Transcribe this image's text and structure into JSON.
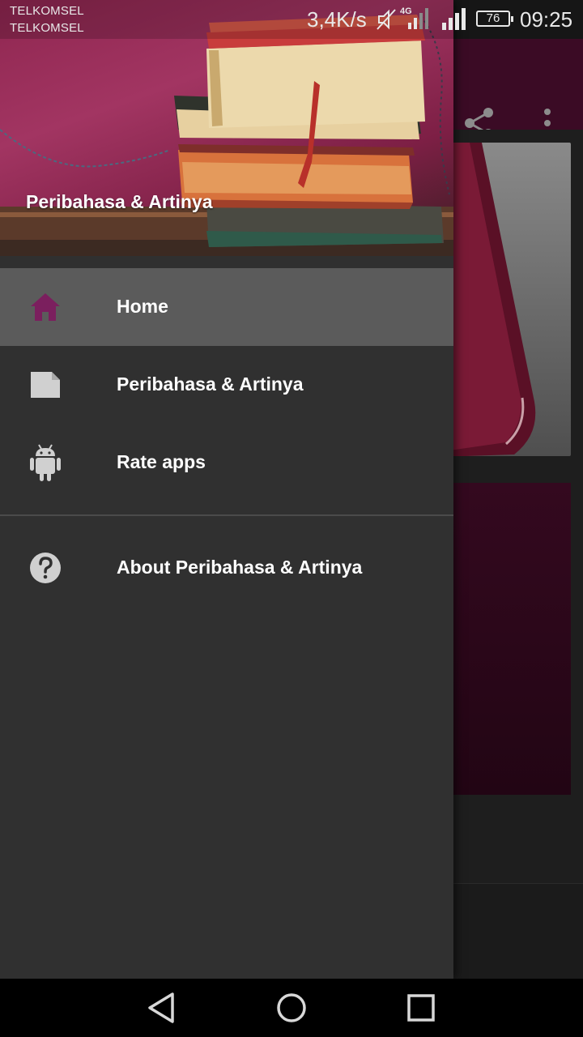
{
  "status_bar": {
    "carrier_1": "TELKOMSEL",
    "carrier_2": "TELKOMSEL",
    "net_speed": "3,4K/s",
    "battery": "76",
    "time": "09:25",
    "icons": [
      "mute-icon",
      "signal-4g-icon",
      "signal-icon",
      "battery-icon"
    ]
  },
  "app_toolbar": {
    "actions": [
      "share-icon",
      "more-vert-icon"
    ]
  },
  "drawer": {
    "header_title": "Peribahasa & Artinya",
    "items": [
      {
        "label": "Home",
        "icon": "home-icon",
        "active": true
      },
      {
        "label": "Peribahasa & Artinya",
        "icon": "note-icon",
        "active": false
      },
      {
        "label": "Rate apps",
        "icon": "android-icon",
        "active": false
      },
      {
        "label": "About Peribahasa & Artinya",
        "icon": "help-icon",
        "active": false
      }
    ]
  },
  "nav_bar": {
    "buttons": [
      "back-icon",
      "home-circle-icon",
      "recents-icon"
    ]
  },
  "colors": {
    "accent": "#7b1f5e",
    "drawer_bg": "#303030",
    "active_item_bg": "#5b5b5b",
    "toolbar": "#3b0b25"
  }
}
